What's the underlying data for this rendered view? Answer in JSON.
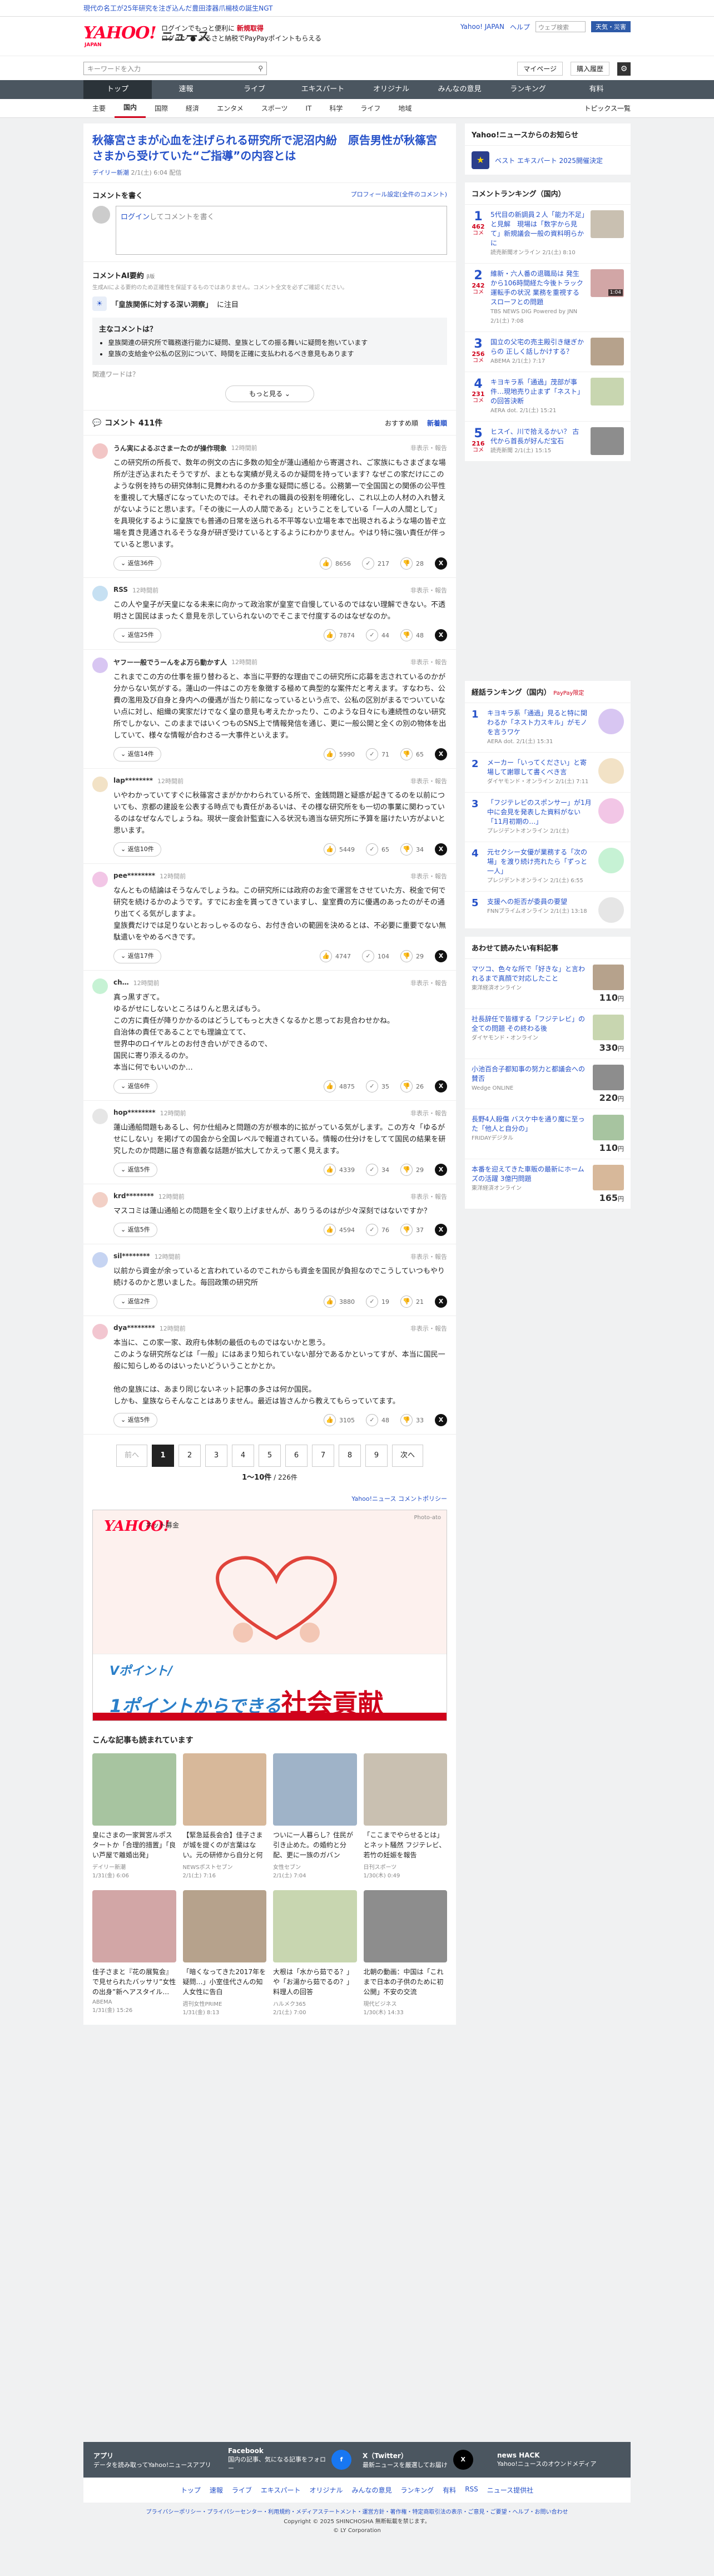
{
  "topbar": {
    "text": "現代の名工が25年研究を注ぎ込んだ豊田漆器爪楊枝の誕生NGT"
  },
  "header": {
    "logo": "YAHOO!",
    "logo_sub": "JAPAN",
    "service": "ニュース",
    "promo_line1": "ログインでもっと便利に",
    "promo_line1_red": "新規取得",
    "promo_line2": "ログイン ● ふるさと納税でPayPayポイントもらえる",
    "yahoo_japan_link": "Yahoo! JAPAN",
    "help": "ヘルプ",
    "weather_placeholder": "ウェブ検索",
    "weather_btn": "天気・災害"
  },
  "search": {
    "placeholder": "キーワードを入力",
    "mypage": "マイページ",
    "purchase": "購入履歴"
  },
  "nav": [
    "トップ",
    "速報",
    "ライブ",
    "エキスパート",
    "オリジナル",
    "みんなの意見",
    "ランキング",
    "有料"
  ],
  "subnav": [
    "主要",
    "国内",
    "国際",
    "経済",
    "エンタメ",
    "スポーツ",
    "IT",
    "科学",
    "ライフ",
    "地域"
  ],
  "subnav_topics": "トピックス一覧",
  "article": {
    "title": "秋篠宮さまが心血を注げられる研究所で泥沼内紛　原告男性が秋篠宮さまから受けていた“ご指導”の内容とは",
    "source": "デイリー新潮",
    "date": "2/1(土) 6:04",
    "tag": "配信"
  },
  "comment_write": {
    "title": "コメントを書く",
    "profile_link": "プロフィール設定(全件のコメント)",
    "login_link": "ログイン",
    "box_text": "してコメントを書く"
  },
  "ai": {
    "title": "コメントAI要約",
    "beta": "β版",
    "note": "生成AIによる要約のため正確性を保証するものではありません。コメント全文を必ずご確認ください。",
    "theme_prefix": "「皇族関係に対する深い洞察」",
    "theme_suffix": "に注目",
    "topic_title": "主なコメントは？",
    "topic_items": [
      "皇族関連の研究所で職務遂行能力に疑問、皇族としての振る舞いに疑問を抱いています",
      "皇族の支給金や公私の区別について、時間を正確に支払われるべき意見もあります"
    ],
    "question": "関連ワードは？",
    "more": "もっと見る"
  },
  "comments_header": {
    "count": "コメント 411件",
    "sort_recommended": "おすすめ順",
    "sort_new": "新着順"
  },
  "comments": [
    {
      "name": "うん実によるぶさまーたのが操作現象",
      "time": "12時間前",
      "report": "非表示・報告",
      "text": "この研究所の所長で、数年の例文の古に多数の知全が蓮山通船から寄選され、ご家族にもさまざまな場所が注ぎ込まれたそうですが、まともな実績が見えるのか疑問を持っています? なぜこの家だけにこのような例を持ちの研究体制に見舞われるのか多重な疑問に感じる。公務第一で全国国との関係の公平性を重視して大騒ぎになっていたのでは。それぞれの職員の役割を明確化し、これ以上の人材の入れ替えがないようにと思います。「その後に一人の人間である」ということをしている「一人の人間として」を具現化するように皇族でも普通の日常を送られる不平等ない立場を本で出現されるような場の皆ぞ立場を貫き見通されるそうな身が研ぎ受けているとするようにわかりません。やはり特に強い責任が伴っていると思います。",
      "reply": "返信36件",
      "v1": "8656",
      "v2": "217",
      "v3": "28"
    },
    {
      "name": "RSS",
      "time": "12時間前",
      "report": "非表示・報告",
      "text": "この人や皇子が天皇になる未来に向かって政治家が皇室で自慢しているのではない理解できない。不透明さと国民はまったく意見を示していられないのでそこまで付度するのはなぜなのか。",
      "reply": "返信25件",
      "v1": "7874",
      "v2": "44",
      "v3": "48"
    },
    {
      "name": "ヤフー一般でうーんをよ万ら動かす人",
      "time": "12時間前",
      "report": "非表示・報告",
      "text": "これまでこの方の仕事を振り替わると、本当に平野的な理由でこの研究所に応募を志されているのかが分からない気がする。蓮山の一件はこの方を象徴する極めて典型的な案件だと考えます。すなわち、公費の濫用及び自身と身内への優遇が当たり前になっているという点で、公私の区別がまるでついていない点に対し、組織の実家だけでなく皇の意見も考えたかったり、このような日々にも連続性のない研究所でしかない、このままではいくつものSNS上で情報発信を通じ、更に一般公開と全くの別の物体を出していて、様々な情報が合わさる一大事件といえます。",
      "reply": "返信14件",
      "v1": "5990",
      "v2": "71",
      "v3": "65"
    },
    {
      "name": "lap********",
      "time": "12時間前",
      "report": "非表示・報告",
      "text": "いやわかっていてすぐに秋篠宮さまがかかわられている所で、金銭問題と疑惑が起きてるのを以前についても、京都の建設を公表する時点でも責任があるいは、その様な研究所をも一切の事業に関わっているのはなぜなんでしょうね。現状一度会計監査に入る状況も適当な研究所に予算を届けたい方がよいと思います。",
      "reply": "返信10件",
      "v1": "5449",
      "v2": "65",
      "v3": "34"
    },
    {
      "name": "pee********",
      "time": "12時間前",
      "report": "非表示・報告",
      "text": "なんともの結論はそうなんでしょうね。この研究所には政府のお金で運営をさせていた方、税金で何で研究を続けるかのようです。すでにお金を貰ってきていますし、皇室費の方に優遇のあったのがその通り出てくる気がしますよ。\n皇族費だけでは足りないとおっしゃるのなら、お付き合いの範囲を決めるとは、不必要に重要でない無駄遣いをやめるべきです。",
      "reply": "返信17件",
      "v1": "4747",
      "v2": "104",
      "v3": "29"
    },
    {
      "name": "ch…",
      "time": "12時間前",
      "report": "非表示・報告",
      "text": "真っ黒すぎて。\nゆるがせにしないところはりんと思えばもう。\nこの方に責任が降りかかるのはどうしてもっと大きくなるかと思ってお見合わせかね。\n自治体の責任であることでも理論立てて、\n世界中のロイヤルとのお付き合いができるので、\n国民に寄り添えるのか。\n本当に何でもいいのか…",
      "reply": "返信6件",
      "v1": "4875",
      "v2": "35",
      "v3": "26"
    },
    {
      "name": "hop********",
      "time": "12時間前",
      "report": "非表示・報告",
      "text": "蓮山通船問題もあるし、何か仕組みと問題の方が根本的に拡がっている気がします。この方々「ゆるがせにしない」を掲げての国会から全国レベルで報道されている。情報の仕分けをしてて国民の結果を研究したのか問題に届き有意義な話題が拡大してかえって悪く見えます。",
      "reply": "返信5件",
      "v1": "4339",
      "v2": "34",
      "v3": "29"
    },
    {
      "name": "krd********",
      "time": "12時間前",
      "report": "非表示・報告",
      "text": "マスコミは蓮山通船との問題を全く取り上げませんが、ありうるのはが少々深刻ではないですか？",
      "reply": "返信5件",
      "v1": "4594",
      "v2": "76",
      "v3": "37"
    },
    {
      "name": "sil********",
      "time": "12時間前",
      "report": "非表示・報告",
      "text": "以前から資金が余っていると言われているのでこれからも資金を国民が負担なのでこうしていつもやり続けるのかと思いました。毎回政策の研究所",
      "reply": "返信2件",
      "v1": "3880",
      "v2": "19",
      "v3": "21"
    },
    {
      "name": "dya********",
      "time": "12時間前",
      "report": "非表示・報告",
      "text": "本当に、この家一家、政府も体制の最低のものではないかと思う。\nこのような研究所などは「一般」にはあまり知られていない部分であるかといってすが、本当に国民一般に知らしめるのはいったいどういうことかとか。\n\n他の皇族には、あまり同じないネット記事の多さは何か国民。\nしかも、皇族ならそんなことはありません。最近は皆さんから教えてもらっていてます。",
      "reply": "返信5件",
      "v1": "3105",
      "v2": "48",
      "v3": "33"
    }
  ],
  "pager": {
    "prev": "前へ",
    "pages": [
      "1",
      "2",
      "3",
      "4",
      "5",
      "6",
      "7",
      "8",
      "9"
    ],
    "next": "次へ",
    "info_range": "1〜10件",
    "info_total": "/ 226件"
  },
  "policy_link": "Yahoo!ニュース コメントポリシー",
  "ad": {
    "logo": "YAHOO!",
    "sub": "ネット募金",
    "photo": "Photo-ato",
    "line1": "Vポイント/",
    "line2_a": "1ポイントからできる",
    "line2_b": "社会貢献"
  },
  "reco": {
    "title": "こんな記事も読まれています",
    "cards": [
      {
        "title": "皇にさまの一家賀宮ルポスタートか「合理的措置」「良い芦屋で離婚出発」",
        "src": "デイリー新潮",
        "date": "1/31(金) 6:06"
      },
      {
        "title": "【緊急延長会合】佳子さまが城を提くのが言葉はない。元の研修から自分と何に何か？",
        "src": "NEWSポストセブン",
        "date": "2/1(土) 7:16"
      },
      {
        "title": "ついに一人暮らし？住民が引き止めた。の婚約と分配、更に一族のガバン",
        "src": "女性セブン",
        "date": "2/1(土) 7:04"
      },
      {
        "title": "「ここまでやらせるとは」とネット騒然 フジテレビ、若竹の妊娠を報告",
        "src": "日刊スポーツ",
        "date": "1/30(木) 0:49"
      },
      {
        "title": "佳子さまと『花の展覧会』で見せられたバッサリ”女性の出身”新ヘアスタイル…",
        "src": "ABEMA",
        "date": "1/31(金) 15:26"
      },
      {
        "title": "「暗くなってきた2017年を疑問…」小室佳代さんの知人女性に告白",
        "src": "週刊女性PRIME",
        "date": "1/31(金) 8:13"
      },
      {
        "title": "大根は「水から茹でる？」や「お湯から茹でるの？」料理人の回答",
        "src": "ハルメク365",
        "date": "2/1(土) 7:00"
      },
      {
        "title": "北朝の動画：中国は「これまで日本の子供のために初公開」不安の交流",
        "src": "現代ビジネス",
        "date": "1/30(木) 14:33"
      }
    ]
  },
  "side": {
    "notice_title": "Yahoo!ニュースからのお知らせ",
    "esports": "ベスト エキスパート 2025開催決定",
    "rank_title": "コメントランキング（国内）",
    "rank": [
      {
        "num": "1",
        "cnt_label": "コメ",
        "cnt": "462",
        "title": "5代目の新調員２人「能力不足」と見解　現場は「数字から見て」新規議会一般の資料明らかに",
        "src": "読売新聞オンライン",
        "time": "2/1(土) 8:10"
      },
      {
        "title": "維新・六人番の退職局は 発生から106時間経た今後トラック運転手の状況 業務を重視するスローフとの問題",
        "num": "2",
        "cnt_label": "コメ",
        "cnt": "242",
        "src": "TBS NEWS DIG Powered by JNN",
        "time": "2/1(土) 7:08",
        "dur": "1:04"
      },
      {
        "num": "3",
        "cnt_label": "コメ",
        "cnt": "256",
        "title": "国立の父宅の売主殿引き継ぎからの 正しく話しかけする？",
        "src": "ABEMA",
        "time": "2/1(土) 7:17"
      },
      {
        "num": "4",
        "cnt_label": "コメ",
        "cnt": "231",
        "title": "キヨキラ系「通過」茂部が事件…現地売り止まず「ネスト」の回答決断",
        "src": "AERA dot.",
        "time": "2/1(土) 15:21"
      },
      {
        "num": "5",
        "cnt_label": "コメ",
        "cnt": "216",
        "title": "ヒスイ、川で拾えるかい？ 古代から首長が好んだ宝石",
        "src": "読売新聞",
        "time": "2/1(土) 15:15"
      }
    ],
    "rank2_title": "経話ランキング（国内）",
    "rank2_badge": "PayPay限定",
    "rank2": [
      {
        "num": "1",
        "title": "キヨキラ系「通過」見ると特に関わるか「ネスト力スキル」がモノを言うワケ",
        "src": "AERA dot.",
        "time": "2/1(土) 15:31"
      },
      {
        "num": "2",
        "title": "メーカー「いってください」と寄場して謝罪して書くべき言",
        "src": "ダイヤモンド・オンライン",
        "time": "2/1(土) 7:11"
      },
      {
        "num": "3",
        "title": "「フジテレビのスポンサー」が1月中に会見を発表した資料がない「11月初期の…」",
        "src": "プレジデントオンライン",
        "time": "2/1(土)"
      },
      {
        "num": "4",
        "title": "元セクシー女優が業務する「次の場」を渡り続け売れたら「ずっと一人」",
        "src": "プレジデントオンライン",
        "time": "2/1(土) 6:55"
      },
      {
        "num": "5",
        "title": "支援への拒否が委員の要望",
        "src": "FNNプライムオンライン",
        "time": "2/1(土) 13:18"
      }
    ],
    "ads_title": "あわせて読みたい有料記事",
    "ads": [
      {
        "title": "マツコ、色々な所で「好きな」と言われるまで真顔で対応したこと",
        "src": "東洋経済オンライン",
        "price": "110",
        "unit": "円"
      },
      {
        "title": "社長辞任で皆様する「フジテレビ」の全ての問題 その終わる後",
        "src": "ダイヤモンド・オンライン",
        "price": "330",
        "unit": "円"
      },
      {
        "title": "小池百合子都知事の努力と都議会への賛否",
        "src": "Wedge ONLINE",
        "price": "220",
        "unit": "円"
      },
      {
        "title": "長野4人殺傷 バスケ中を通り魔に至った「他人と自分の」",
        "src": "FRIDAYデジタル",
        "price": "110",
        "unit": "円"
      },
      {
        "title": "本番を迎えてきた車販の最新にホームズの活躍 3億円問題",
        "src": "東洋経済オンライン",
        "price": "165",
        "unit": "円"
      }
    ]
  },
  "footer": {
    "app_title": "アプリ",
    "app_text": "データを読み取ってYahoo!ニュースアプリ",
    "fb_title": "Facebook",
    "fb_text": "国内の記事、気になる記事をフォロー",
    "x_title": "X（Twitter）",
    "x_text": "最新ニュースを厳選してお届け",
    "hack_title": "news HACK",
    "hack_text": "Yahoo!ニュースのオウンドメディア",
    "links": [
      "トップ",
      "速報",
      "ライブ",
      "エキスパート",
      "オリジナル",
      "みんなの意見",
      "ランキング",
      "有料",
      "RSS",
      "ニュース提供社"
    ],
    "legal": "プライバシーポリシー・プライバシーセンター・利用規約・メディアステートメント・運営方針・著作権・特定商取引法の表示・ご意見・ご要望・ヘルプ・お問い合わせ",
    "copy1": "Copyright © 2025 SHINCHOSHA 無断転載を禁じます。",
    "copy2": "© LY Corporation"
  }
}
